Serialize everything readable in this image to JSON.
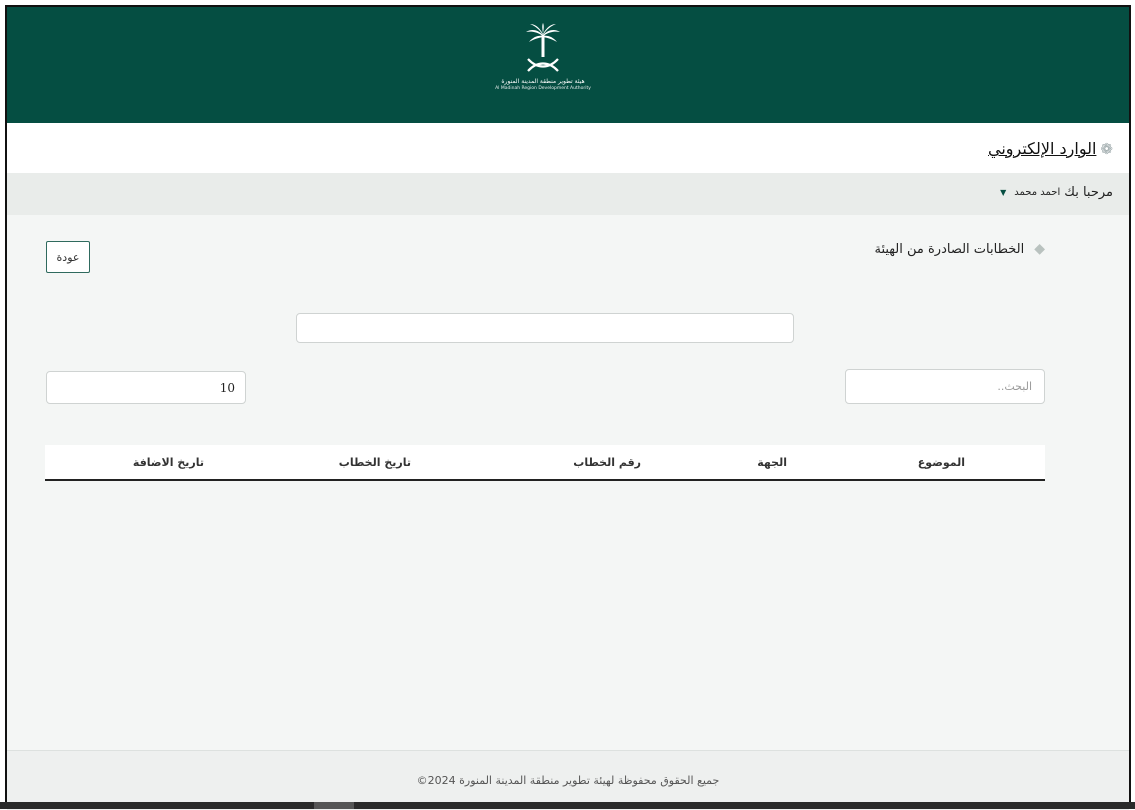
{
  "logo": {
    "org_ar": "هيئة تطوير منطقة المدينة المنورة",
    "org_en": "Al Madinah Region Development Authority"
  },
  "page_title": "الوارد الإلكتروني",
  "welcome": {
    "greeting": "مرحبا بك",
    "user_name": "احمد محمد"
  },
  "section_title": "الخطابات الصادرة من الهيئة",
  "back_button": "عودة",
  "filter": {
    "value": ""
  },
  "page_size": {
    "value": "10"
  },
  "search": {
    "placeholder": "البحث..",
    "value": ""
  },
  "table": {
    "columns": [
      "الموضوع",
      "الجهة",
      "رقم الخطاب",
      "تاريخ الخطاب",
      "تاريخ الاضافة"
    ],
    "rows": []
  },
  "footer": "جميع الحقوق محفوظة لهيئة تطوير منطقة المدينة المنورة 2024©",
  "colors": {
    "header_green": "#054e42",
    "page_bg": "#f4f6f5",
    "welcome_bg": "#e9ecea"
  }
}
